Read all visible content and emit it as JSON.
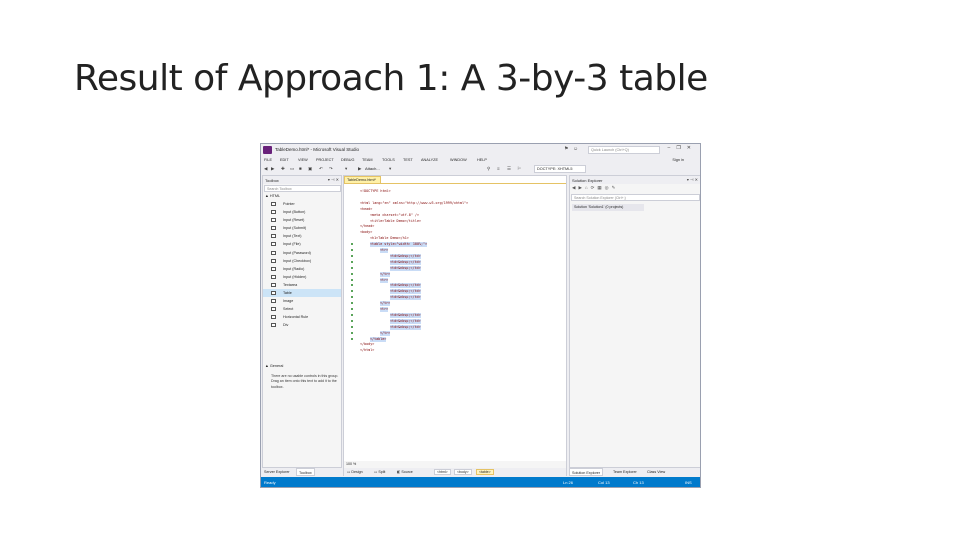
{
  "slide": {
    "title": "Result of Approach 1: A 3-by-3 table"
  },
  "window": {
    "title": "TableDemo.html* - Microsoft Visual Studio",
    "quick_launch": "Quick Launch (Ctrl+Q)",
    "sign_in": "Sign in"
  },
  "menu": [
    "FILE",
    "EDIT",
    "VIEW",
    "PROJECT",
    "DEBUG",
    "TEAM",
    "TOOLS",
    "TEST",
    "ANALYZE",
    "WINDOW",
    "HELP"
  ],
  "toolbar": {
    "attach": "Attach...",
    "doctype": "DOCTYPE: XHTML5"
  },
  "toolbox": {
    "title": "Toolbox",
    "search_placeholder": "Search Toolbox",
    "group_html": "▲ HTML",
    "items": [
      "Pointer",
      "Input (Button)",
      "Input (Reset)",
      "Input (Submit)",
      "Input (Text)",
      "Input (File)",
      "Input (Password)",
      "Input (Checkbox)",
      "Input (Radio)",
      "Input (Hidden)",
      "Textarea",
      "Table",
      "Image",
      "Select",
      "Horizontal Rule",
      "Div"
    ],
    "selected_index": 11,
    "group_general": "▲ General",
    "hint": "There are no usable controls in this group. Drag an item onto this text to add it to the toolbox."
  },
  "editor": {
    "tab": "TableDemo.html*",
    "lines": [
      {
        "i": 0,
        "t": "<!DOCTYPE html>",
        "hl": false
      },
      {
        "i": 0,
        "t": "",
        "hl": false
      },
      {
        "i": 0,
        "t": "<html lang=\"en\" xmlns=\"http://www.w3.org/1999/xhtml\">",
        "hl": false
      },
      {
        "i": 0,
        "t": "<head>",
        "hl": false
      },
      {
        "i": 1,
        "t": "<meta charset=\"utf-8\" />",
        "hl": false
      },
      {
        "i": 1,
        "t": "<title>Table Demo</title>",
        "hl": false
      },
      {
        "i": 0,
        "t": "</head>",
        "hl": false
      },
      {
        "i": 0,
        "t": "<body>",
        "hl": false
      },
      {
        "i": 1,
        "t": "<h1>Table Demo</h1>",
        "hl": false
      },
      {
        "i": 1,
        "t": "<table style=\"width: 100%;\">",
        "hl": true
      },
      {
        "i": 2,
        "t": "<tr>",
        "hl": true
      },
      {
        "i": 3,
        "t": "<td>&nbsp;</td>",
        "hl": true
      },
      {
        "i": 3,
        "t": "<td>&nbsp;</td>",
        "hl": true
      },
      {
        "i": 3,
        "t": "<td>&nbsp;</td>",
        "hl": true
      },
      {
        "i": 2,
        "t": "</tr>",
        "hl": true
      },
      {
        "i": 2,
        "t": "<tr>",
        "hl": true
      },
      {
        "i": 3,
        "t": "<td>&nbsp;</td>",
        "hl": true
      },
      {
        "i": 3,
        "t": "<td>&nbsp;</td>",
        "hl": true
      },
      {
        "i": 3,
        "t": "<td>&nbsp;</td>",
        "hl": true
      },
      {
        "i": 2,
        "t": "</tr>",
        "hl": true
      },
      {
        "i": 2,
        "t": "<tr>",
        "hl": true
      },
      {
        "i": 3,
        "t": "<td>&nbsp;</td>",
        "hl": true
      },
      {
        "i": 3,
        "t": "<td>&nbsp;</td>",
        "hl": true
      },
      {
        "i": 3,
        "t": "<td>&nbsp;</td>",
        "hl": true
      },
      {
        "i": 2,
        "t": "</tr>",
        "hl": true
      },
      {
        "i": 1,
        "t": "</table>",
        "hl": true
      },
      {
        "i": 0,
        "t": "</body>",
        "hl": false
      },
      {
        "i": 0,
        "t": "</html>",
        "hl": false
      }
    ],
    "zoom": "100 %",
    "view_design": "Design",
    "view_split": "Split",
    "view_source": "Source",
    "crumbs": [
      "<html>",
      "<body>",
      "<table>"
    ]
  },
  "solution_explorer": {
    "title": "Solution Explorer",
    "search_placeholder": "Search Solution Explorer (Ctrl+;)",
    "item": "Solution 'Solution1' (0 projects)"
  },
  "bottom_tabs_left": [
    "Server Explorer",
    "Toolbox"
  ],
  "bottom_tabs_right": [
    "Solution Explorer",
    "Team Explorer",
    "Class View"
  ],
  "status": {
    "ready": "Ready",
    "ln": "Ln 26",
    "col": "Col 13",
    "ch": "Ch 13",
    "ins": "INS"
  }
}
